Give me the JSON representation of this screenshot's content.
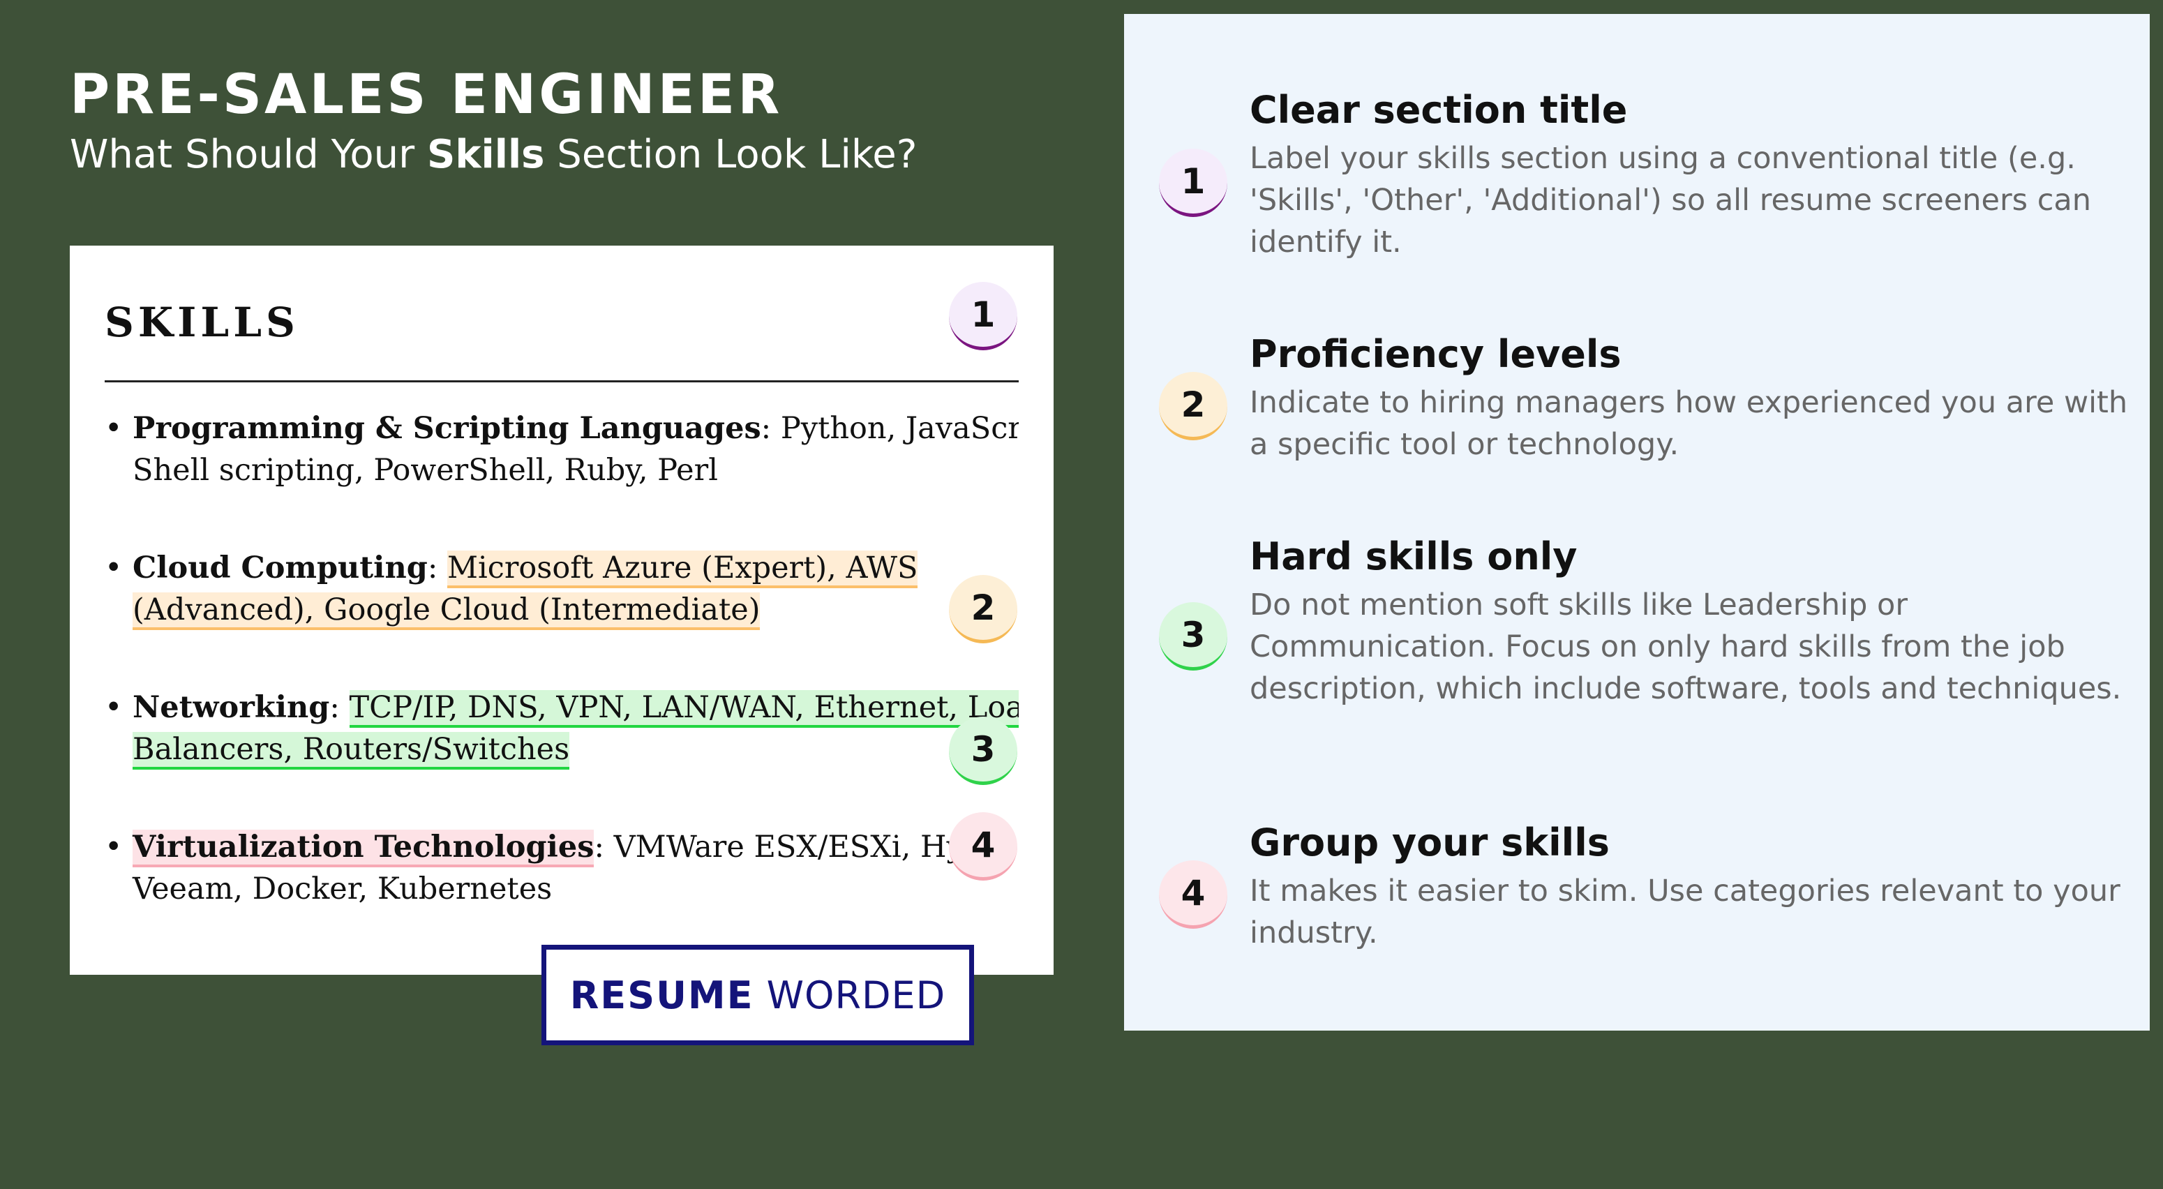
{
  "header": {
    "job_title": "PRE-SALES ENGINEER",
    "subtitle_before": "What Should Your ",
    "subtitle_bold": "Skills",
    "subtitle_after": " Section Look Like?"
  },
  "resume": {
    "heading": "SKILLS",
    "items": [
      {
        "category": "Programming & Scripting Languages",
        "separator": ": ",
        "highlighted": "",
        "line1_rest": "Python, JavaScript,",
        "line2": "Shell scripting, PowerShell, Ruby, Perl"
      },
      {
        "category": "Cloud Computing",
        "separator": ": ",
        "line1_hl": "Microsoft Azure (Expert), AWS",
        "line2_hl": "(Advanced), Google Cloud (Intermediate)"
      },
      {
        "category": "Networking",
        "separator": ": ",
        "line1_hl": "TCP/IP, DNS, VPN, LAN/WAN, Ethernet, Load",
        "line2_hl": "Balancers, Routers/Switches"
      },
      {
        "category": "Virtualization Technologies",
        "separator": ": ",
        "line1_rest": "VMWare ESX/ESXi, Hyper",
        "line2": "Veeam, Docker, Kubernetes"
      }
    ],
    "badges": [
      "1",
      "2",
      "3",
      "4"
    ]
  },
  "logo": {
    "bold": "RESUME",
    "light": "WORDED"
  },
  "tips": [
    {
      "number": "1",
      "title": "Clear section title",
      "body": "Label your skills section using a conventional title (e.g. 'Skills', 'Other', 'Additional') so all resume screeners can identify it."
    },
    {
      "number": "2",
      "title": "Proficiency levels",
      "body": "Indicate to hiring managers how experienced you are with a specific tool or technology."
    },
    {
      "number": "3",
      "title": "Hard skills only",
      "body": "Do not mention soft skills like Leadership or Communication. Focus on only hard skills from the job description, which include software, tools and techniques."
    },
    {
      "number": "4",
      "title": "Group your skills",
      "body": "It makes it easier to skim. Use categories relevant to your industry."
    }
  ],
  "colors": {
    "background": "#3e5138",
    "panel": "#eef5fc",
    "badge_1_accent": "#7b1580",
    "badge_2_accent": "#f5b955",
    "badge_3_accent": "#2fd24a",
    "badge_4_accent": "#f5a3b0",
    "logo": "#14147a"
  }
}
